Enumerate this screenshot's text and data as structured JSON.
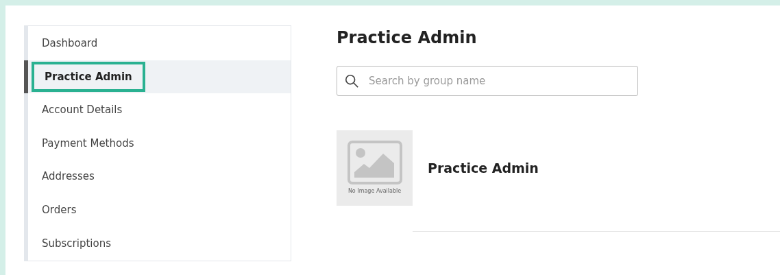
{
  "sidebar": {
    "items": [
      {
        "label": "Dashboard",
        "selected": false
      },
      {
        "label": "Practice Admin",
        "selected": true
      },
      {
        "label": "Account Details",
        "selected": false
      },
      {
        "label": "Payment Methods",
        "selected": false
      },
      {
        "label": "Addresses",
        "selected": false
      },
      {
        "label": "Orders",
        "selected": false
      },
      {
        "label": "Subscriptions",
        "selected": false
      }
    ]
  },
  "title": "Practice Admin",
  "search": {
    "placeholder": "Search by group name"
  },
  "groups": [
    {
      "name": "Practice Admin",
      "image_caption": "No Image Available"
    }
  ]
}
